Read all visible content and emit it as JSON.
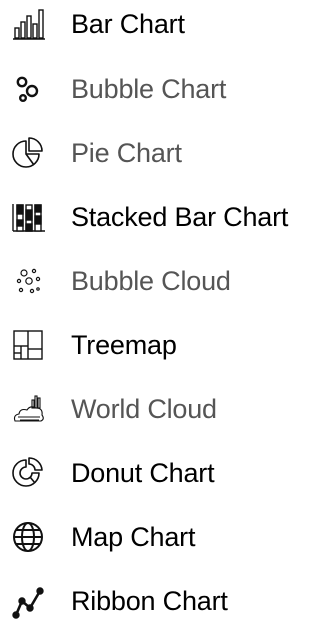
{
  "menu": {
    "items": [
      {
        "label": "Bar Chart",
        "icon": "bar-chart-icon",
        "style": "bold"
      },
      {
        "label": "Bubble Chart",
        "icon": "bubble-chart-icon",
        "style": "light"
      },
      {
        "label": "Pie Chart",
        "icon": "pie-chart-icon",
        "style": "light"
      },
      {
        "label": "Stacked Bar Chart",
        "icon": "stacked-bar-chart-icon",
        "style": "bold"
      },
      {
        "label": "Bubble Cloud",
        "icon": "bubble-cloud-icon",
        "style": "light"
      },
      {
        "label": "Treemap",
        "icon": "treemap-icon",
        "style": "bold"
      },
      {
        "label": "World Cloud",
        "icon": "word-cloud-icon",
        "style": "light"
      },
      {
        "label": "Donut Chart",
        "icon": "donut-chart-icon",
        "style": "bold"
      },
      {
        "label": "Map Chart",
        "icon": "globe-icon",
        "style": "bold"
      },
      {
        "label": "Ribbon Chart",
        "icon": "ribbon-chart-icon",
        "style": "bold"
      }
    ]
  },
  "colors": {
    "text_bold": "#000000",
    "text_light": "#555555",
    "icon": "#111111",
    "background": "#ffffff"
  }
}
